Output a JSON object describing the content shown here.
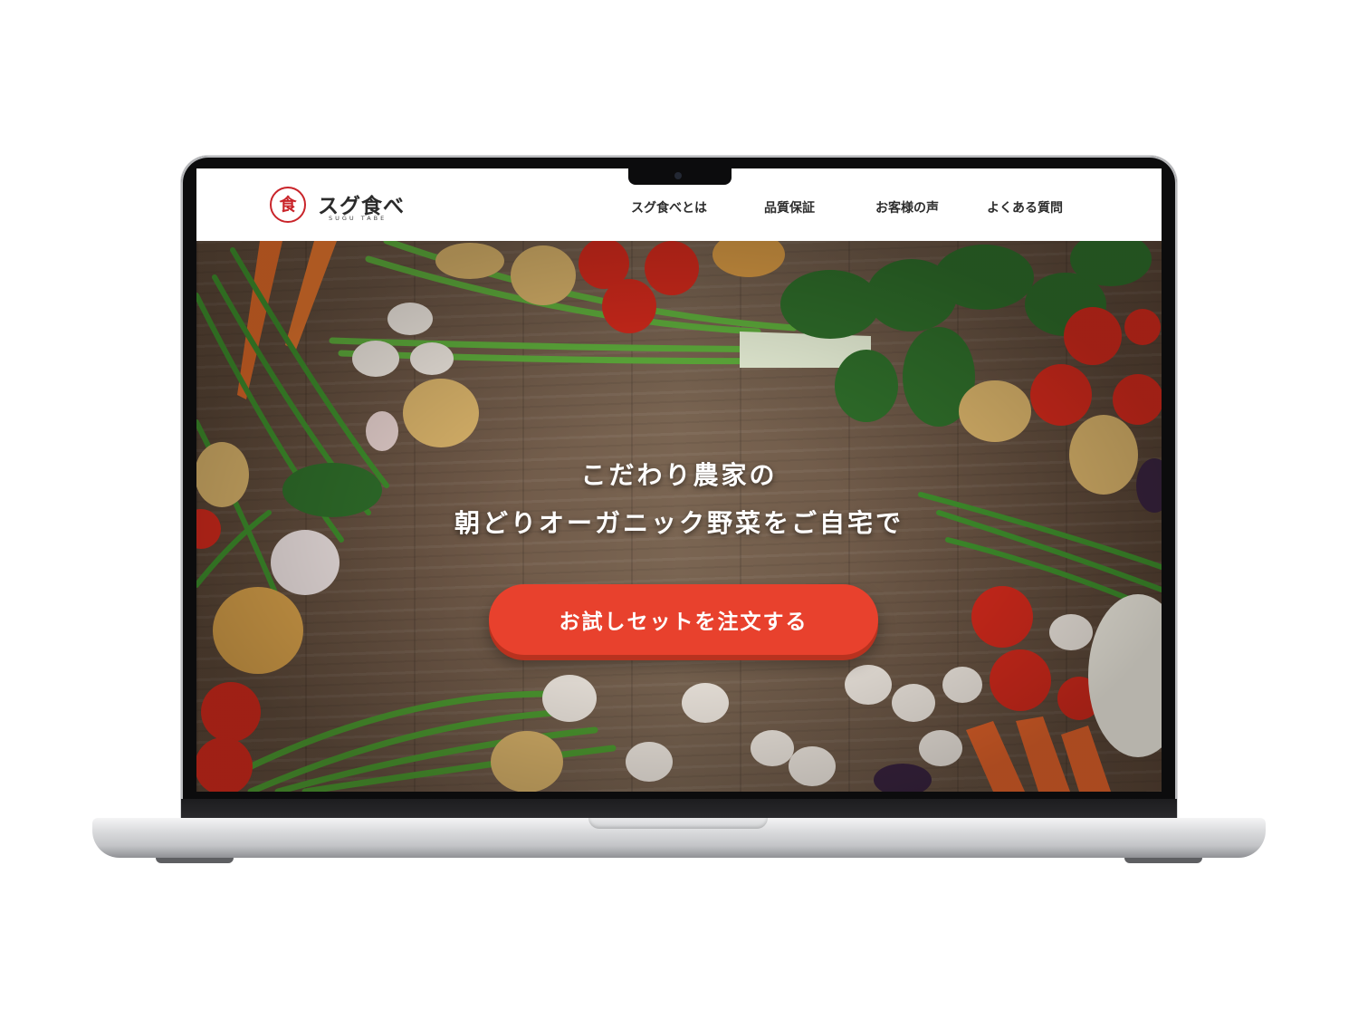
{
  "header": {
    "logo_mark": "食",
    "logo_title": "スグ食べ",
    "logo_subtitle": "SUGU TABE",
    "nav": [
      {
        "label": "スグ食べとは"
      },
      {
        "label": "品質保証"
      },
      {
        "label": "お客様の声"
      },
      {
        "label": "よくある質問"
      }
    ]
  },
  "hero": {
    "headline_line1": "こだわり農家の",
    "headline_line2": "朝どりオーガニック野菜をご自宅で",
    "cta_label": "お試しセットを注文する"
  },
  "colors": {
    "brand_red": "#c9242a",
    "cta": "#e8412d",
    "wood": "#6d5746"
  }
}
